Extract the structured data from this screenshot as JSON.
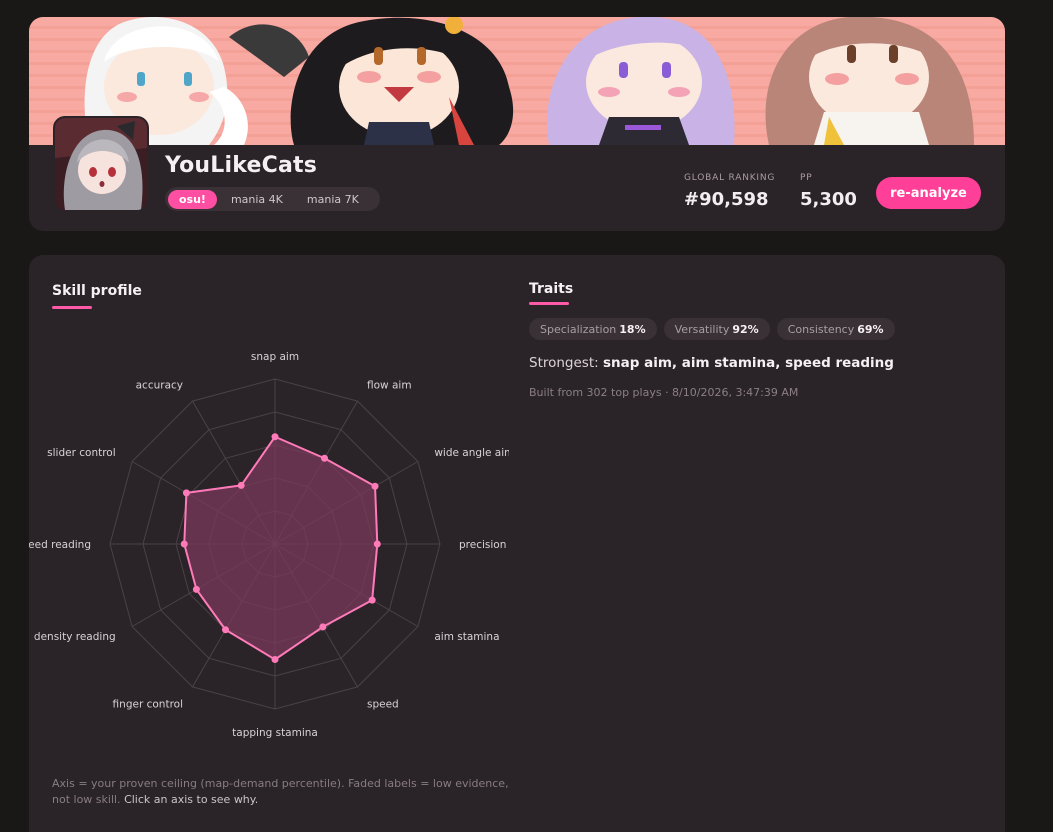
{
  "profile": {
    "username": "YouLikeCats",
    "modes": [
      "osu!",
      "mania 4K",
      "mania 7K"
    ],
    "active_mode": "osu!",
    "global_ranking_label": "GLOBAL RANKING",
    "global_ranking": "#90,598",
    "pp_label": "PP",
    "pp": "5,300",
    "reanalyze_label": "re-analyze"
  },
  "skill_profile": {
    "title": "Skill profile",
    "footnote_main": "Axis = your proven ceiling (map-demand percentile). Faded labels = low evidence, not low skill.",
    "footnote_cta": "Click an axis to see why."
  },
  "traits": {
    "title": "Traits",
    "specialization_label": "Specialization",
    "specialization_value": "18%",
    "versatility_label": "Versatility",
    "versatility_value": "92%",
    "consistency_label": "Consistency",
    "consistency_value": "69%",
    "strongest_label": "Strongest:",
    "strongest_value": "snap aim, aim stamina, speed reading",
    "built_from": "Built from 302 top plays · 8/10/2026, 3:47:39 AM"
  },
  "colors": {
    "accent": "#ff4fa3",
    "radar_stroke": "#ff7ab8",
    "radar_fill": "#7a3a5a",
    "card_bg": "#2a2328",
    "page_bg": "#1a1717"
  },
  "chart_data": {
    "type": "radar",
    "categories": [
      "snap aim",
      "flow aim",
      "wide angle aim",
      "precision",
      "aim stamina",
      "speed",
      "tapping stamina",
      "finger control",
      "density reading",
      "speed reading",
      "slider control",
      "accuracy"
    ],
    "values": [
      0.65,
      0.6,
      0.7,
      0.62,
      0.68,
      0.58,
      0.7,
      0.6,
      0.55,
      0.55,
      0.62,
      0.41
    ],
    "rings": 5,
    "max": 1.0
  }
}
